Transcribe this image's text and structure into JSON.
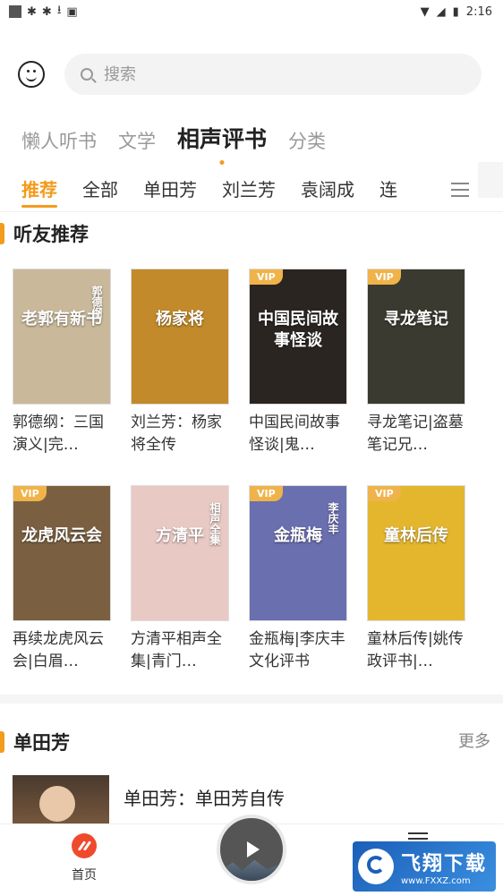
{
  "status_bar": {
    "time": "2:16"
  },
  "search": {
    "placeholder": "搜索"
  },
  "top_tabs": [
    {
      "label": "懒人听书"
    },
    {
      "label": "文学"
    },
    {
      "label": "相声评书",
      "active": true
    },
    {
      "label": "分类"
    }
  ],
  "sub_tabs": [
    {
      "label": "推荐",
      "active": true
    },
    {
      "label": "全部"
    },
    {
      "label": "单田芳"
    },
    {
      "label": "刘兰芳"
    },
    {
      "label": "袁阔成"
    },
    {
      "label": "连"
    }
  ],
  "section_recommend": {
    "title": "听友推荐",
    "books": [
      {
        "title": "郭德纲：三国演义|完…",
        "vip": false,
        "cover_text": "老郭有新书",
        "cover_top": "郭德纲",
        "cover_color": "#c9b89a"
      },
      {
        "title": "刘兰芳：杨家将全传",
        "vip": false,
        "cover_text": "杨家将",
        "cover_top": "",
        "cover_color": "#c28a2a"
      },
      {
        "title": "中国民间故事怪谈|鬼…",
        "vip": true,
        "vip_label": "VIP",
        "cover_text": "中国民间故事怪谈",
        "cover_top": "",
        "cover_color": "#2b2522"
      },
      {
        "title": "寻龙笔记|盗墓笔记兄…",
        "vip": true,
        "vip_label": "VIP",
        "cover_text": "寻龙笔记",
        "cover_top": "",
        "cover_color": "#3a3a30"
      },
      {
        "title": "再续龙虎风云会|白眉…",
        "vip": true,
        "vip_label": "VIP",
        "cover_text": "龙虎风云会",
        "cover_top": "",
        "cover_color": "#7a6040"
      },
      {
        "title": "方清平相声全集|青门…",
        "vip": false,
        "cover_text": "方清平",
        "cover_top": "相声全集",
        "cover_color": "#e9c9c4"
      },
      {
        "title": "金瓶梅|李庆丰文化评书",
        "vip": true,
        "vip_label": "VIP",
        "cover_text": "金瓶梅",
        "cover_top": "李庆丰",
        "cover_color": "#6a6fb0"
      },
      {
        "title": "童林后传|姚传政评书|…",
        "vip": true,
        "vip_label": "VIP",
        "cover_text": "童林后传",
        "cover_top": "",
        "cover_color": "#e4b62e"
      }
    ]
  },
  "section_shantianfang": {
    "title": "单田芳",
    "more_label": "更多",
    "first_item": {
      "title": "单田芳：单田芳自传"
    }
  },
  "bottom_nav": {
    "home_label": "首页"
  },
  "watermark": {
    "cn": "飞翔下载",
    "en": "www.FXXZ.com"
  }
}
